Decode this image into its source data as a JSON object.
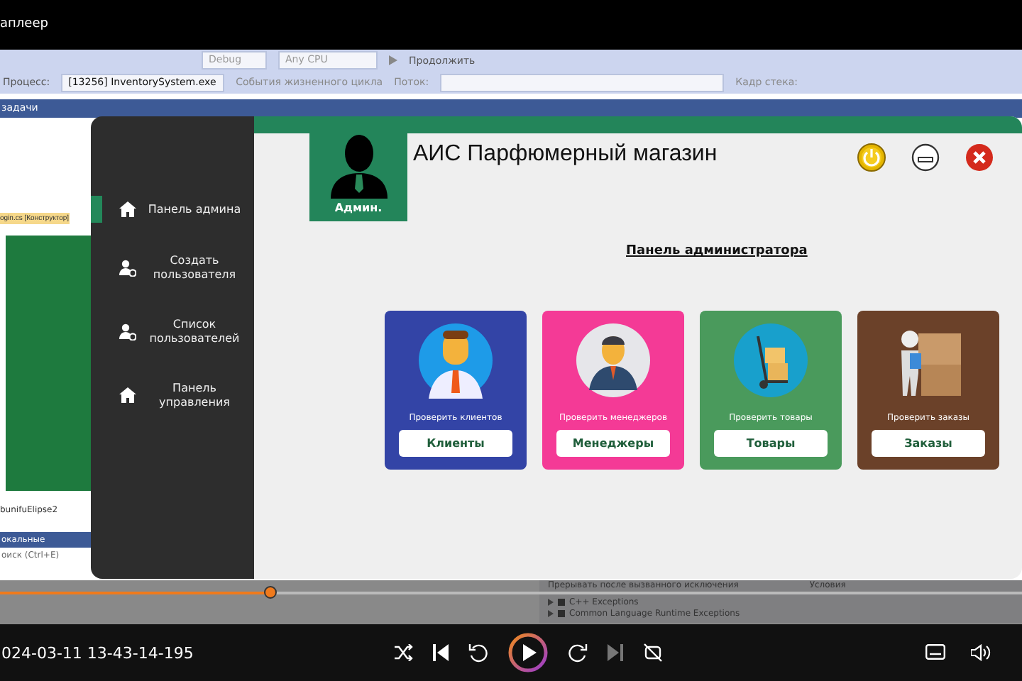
{
  "player": {
    "title": "аплеер",
    "timestamp": "024-03-11 13-43-14-195",
    "seek": {
      "level": 0.265
    }
  },
  "ide": {
    "configuration": "Debug",
    "platform": "Any CPU",
    "continue": "Продолжить",
    "process_label": "Процесс:",
    "process": "[13256] InventorySystem.exe",
    "lifecycle": "События жизненного цикла",
    "thread_label": "Поток:",
    "frame_label": "Кадр стека:",
    "tasks_bar": "задачи",
    "designer_tab": "ogin.cs [Конструктор]",
    "component": "bunifuElipse2",
    "locals_header": "окальные",
    "search_placeholder": "оиск (Ctrl+E)",
    "exceptions": {
      "header": "Прерывать после вызванного исключения",
      "column": "Условия",
      "items": [
        "C++ Exceptions",
        "Common Language Runtime Exceptions"
      ]
    }
  },
  "app": {
    "title": "АИС Парфюмерный магазин",
    "role": "Админ.",
    "heading": "Панель администратора",
    "menu": [
      {
        "label": "Панель админа",
        "kind": "home",
        "selected": true
      },
      {
        "label": "Создать пользователя",
        "kind": "user",
        "selected": false
      },
      {
        "label": "Список пользователей",
        "kind": "user",
        "selected": false
      },
      {
        "label": "Панель управления",
        "kind": "home",
        "selected": false
      }
    ],
    "cards": [
      {
        "caption": "Проверить клиентов",
        "button": "Клиенты",
        "color": "#3344a6",
        "kind": "client"
      },
      {
        "caption": "Проверить менеджеров",
        "button": "Менеджеры",
        "color": "#f43a96",
        "kind": "manager"
      },
      {
        "caption": "Проверить товары",
        "button": "Товары",
        "color": "#4a9a5c",
        "kind": "goods"
      },
      {
        "caption": "Проверить заказы",
        "button": "Заказы",
        "color": "#6b4129",
        "kind": "orders"
      }
    ]
  }
}
